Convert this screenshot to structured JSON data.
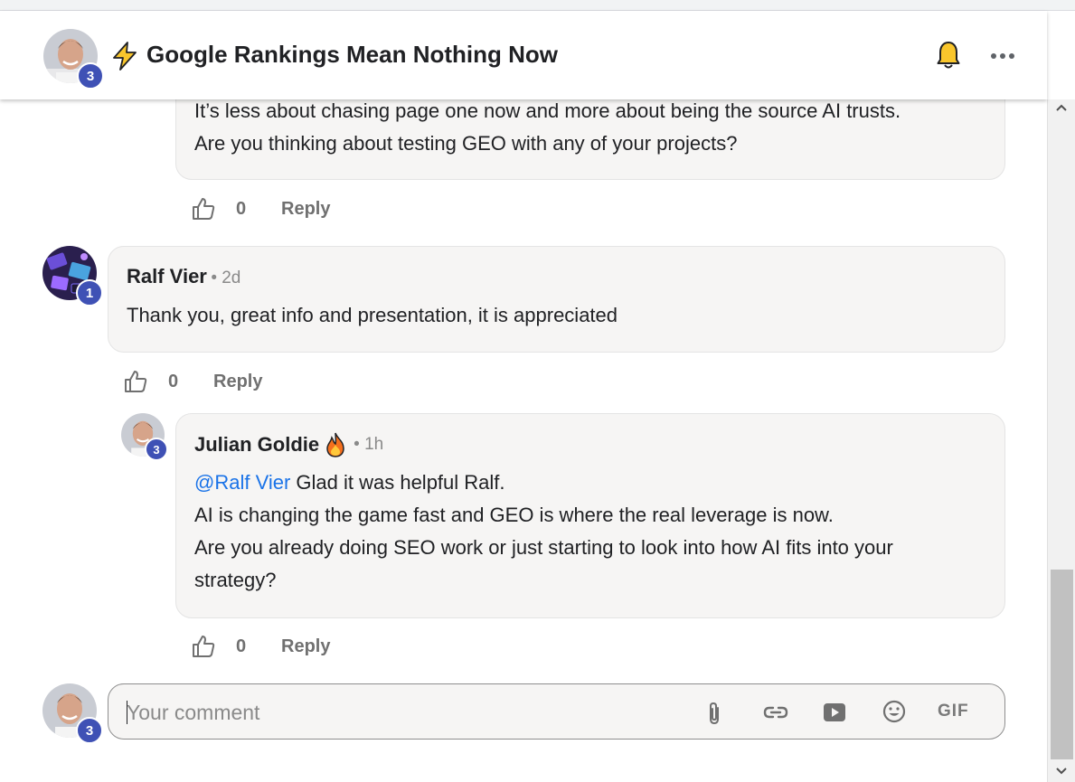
{
  "header": {
    "title": "Google Rankings Mean Nothing Now",
    "author_badge": "3"
  },
  "comments": [
    {
      "lines": [
        "It’s less about chasing page one now and more about being the source AI trusts.",
        "Are you thinking about testing GEO with any of your projects?"
      ],
      "likes": "0",
      "reply_label": "Reply"
    },
    {
      "author": "Ralf Vier",
      "time": "• 2d",
      "badge": "1",
      "lines": [
        "Thank you, great info and presentation, it is appreciated"
      ],
      "likes": "0",
      "reply_label": "Reply"
    },
    {
      "author": "Julian Goldie",
      "time": "• 1h",
      "badge": "3",
      "mention": "@Ralf Vier",
      "first_line_rest": " Glad it was helpful Ralf.",
      "lines": [
        "AI is changing the game fast and GEO is where the real leverage is now.",
        "Are you already doing SEO work or just starting to look into how AI fits into your",
        "strategy?"
      ],
      "likes": "0",
      "reply_label": "Reply"
    }
  ],
  "composer": {
    "placeholder": "Your comment",
    "badge": "3",
    "gif_label": "GIF",
    "tools": [
      "paperclip-icon",
      "link-icon",
      "youtube-icon",
      "emoji-icon",
      "gif-button"
    ]
  },
  "colors": {
    "badge": "#3f51b5",
    "mention": "#1a73e8",
    "bell": "#f9c62c",
    "bolt": "#f9c62c"
  }
}
